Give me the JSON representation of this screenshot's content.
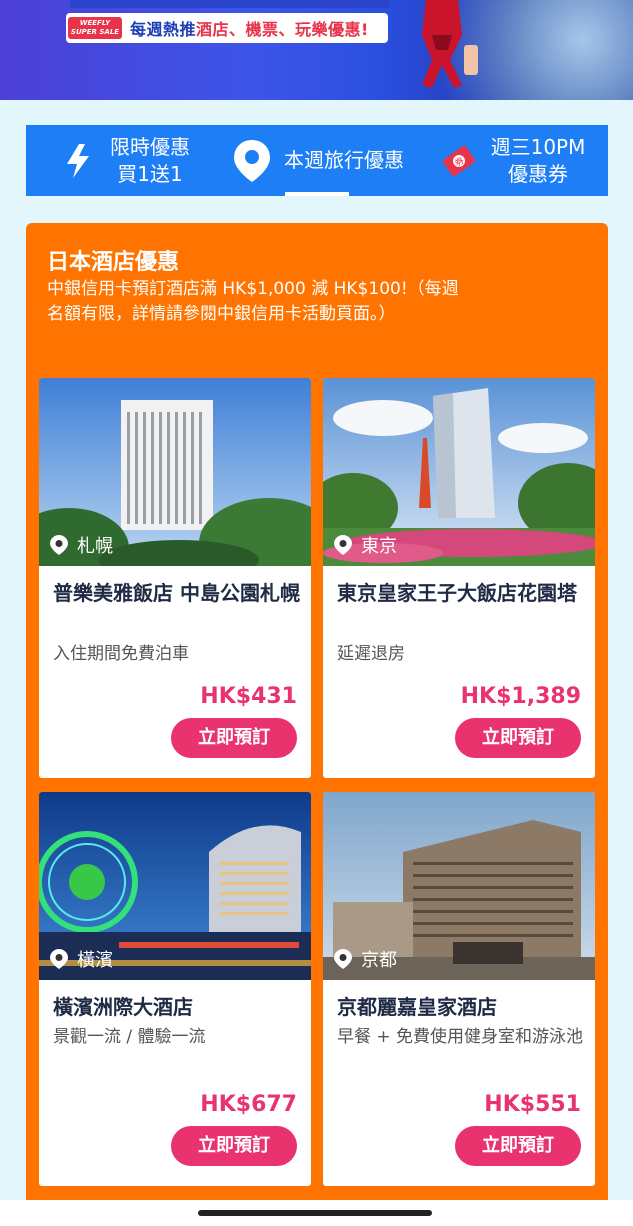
{
  "banner": {
    "logo_text": "WEEFLY SUPER SALE",
    "headline_prefix": "每週熱推",
    "headline_highlight": "酒店、機票、玩樂優惠!"
  },
  "tabs": [
    {
      "label": "限時優惠\n買1送1",
      "icon": "lightning-icon"
    },
    {
      "label": "本週旅行優惠",
      "icon": "location-pin-icon",
      "active": true
    },
    {
      "label": "週三10PM\n優惠券",
      "icon": "coupon-icon"
    }
  ],
  "section": {
    "title": "日本酒店優惠",
    "description": "中銀信用卡預訂酒店滿 HK$1,000 減 HK$100!（每週名額有限，詳情請參閱中銀信用卡活動頁面。）"
  },
  "hotels": [
    {
      "location": "札幌",
      "name": "普樂美雅飯店 中島公園札幌",
      "feature": "入住期間免費泊車",
      "price": "HK$431",
      "button": "立即預訂"
    },
    {
      "location": "東京",
      "name": "東京皇家王子大飯店花園塔",
      "feature": "延遲退房",
      "price": "HK$1,389",
      "button": "立即預訂"
    },
    {
      "location": "橫濱",
      "name": "橫濱洲際大酒店",
      "feature": "景觀一流 / 體驗一流",
      "price": "HK$677",
      "button": "立即預訂"
    },
    {
      "location": "京都",
      "name": "京都麗嘉皇家酒店",
      "feature": "早餐 + 免費使用健身室和游泳池",
      "price": "HK$551",
      "button": "立即預訂"
    }
  ],
  "colors": {
    "tab_bar": "#1d7ef5",
    "panel": "#ff7300",
    "price": "#e8336e",
    "button": "#e8336e",
    "page_bg": "#e3f6fc"
  }
}
